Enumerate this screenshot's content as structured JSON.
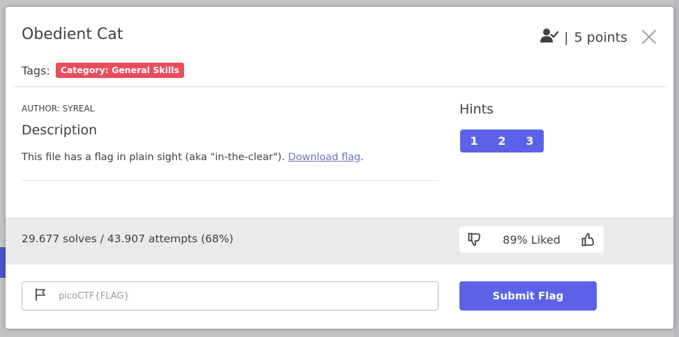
{
  "modal": {
    "title": "Obedient Cat",
    "points": "5 points",
    "separator": "|",
    "tags_label": "Tags:",
    "tags": [
      "Category: General Skills"
    ],
    "author": "AUTHOR: SYREAL",
    "description_title": "Description",
    "description_text": "This file has a flag in plain sight (aka \"in-the-clear\"). ",
    "download_link": "Download flag",
    "description_end": ".",
    "hints_title": "Hints",
    "hints": [
      "1",
      "2",
      "3"
    ],
    "solves_text": "29.677 solves / 43.907 attempts (68%)",
    "liked_text": "89% Liked",
    "flag_placeholder": "picoCTF{FLAG}",
    "submit_label": "Submit Flag"
  },
  "colors": {
    "accent": "#5b62e8",
    "tag": "#e84d5c",
    "link": "#6b72c9",
    "band": "#eaeaea"
  },
  "icons": [
    "user-check-icon",
    "close-icon",
    "flag-icon",
    "thumbs-down-icon",
    "thumbs-up-icon"
  ]
}
